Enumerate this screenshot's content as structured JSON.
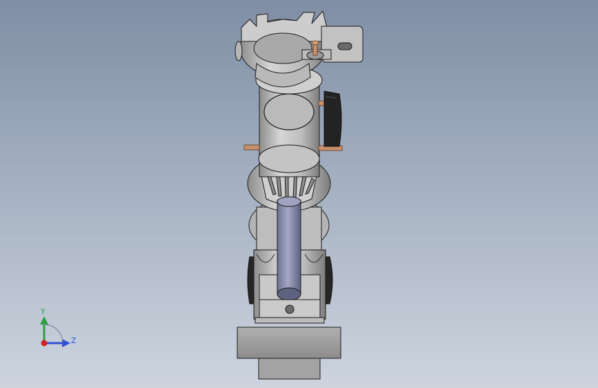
{
  "viewport": {
    "background_top": "#7f8ea5",
    "background_bottom": "#cdd4de"
  },
  "triad": {
    "y_label": "Y",
    "z_label": "Z",
    "y_color": "#2ea043",
    "z_color": "#2f4fd6",
    "origin_color": "#d42020"
  },
  "model": {
    "part_color": "#b8b8b8",
    "edge_color": "#1a1a1a",
    "rod_color": "#8a8fb0",
    "pin_color": "#c8906a",
    "pad_color": "#2b2b2b"
  }
}
